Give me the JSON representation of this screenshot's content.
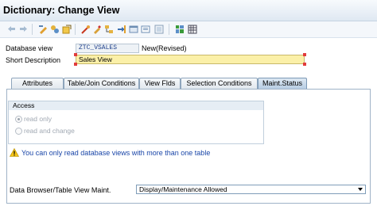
{
  "window": {
    "title": "Dictionary: Change View"
  },
  "toolbar": {
    "icons": [
      "back-arrow-icon",
      "forward-arrow-icon",
      "display-change-icon",
      "other-object-icon",
      "check-icon",
      "activate-icon",
      "where-used-icon",
      "hierarchy-icon",
      "display-object-list-icon",
      "window-icon",
      "information-icon",
      "technical-settings-icon",
      "table-contents-icon"
    ]
  },
  "header": {
    "database_view_label": "Database view",
    "database_view_value": "ZTC_VSALES",
    "status": "New(Revised)",
    "short_description_label": "Short Description",
    "short_description_value": "Sales View"
  },
  "tabs": [
    {
      "label": "Attributes",
      "active": false
    },
    {
      "label": "Table/Join Conditions",
      "active": false
    },
    {
      "label": "View Flds",
      "active": false
    },
    {
      "label": "Selection Conditions",
      "active": false
    },
    {
      "label": "Maint.Status",
      "active": true
    }
  ],
  "access": {
    "title": "Access",
    "options": [
      {
        "label": "read only",
        "selected": true
      },
      {
        "label": "read and change",
        "selected": false
      }
    ]
  },
  "message": {
    "text": "You can only read database views with more than one table",
    "color": "#1a46a8"
  },
  "maintenance": {
    "label": "Data Browser/Table View Maint.",
    "value": "Display/Maintenance Allowed"
  },
  "colors": {
    "short_description_bg": "#fbf0a8",
    "active_tab": "#c3d6ea"
  }
}
